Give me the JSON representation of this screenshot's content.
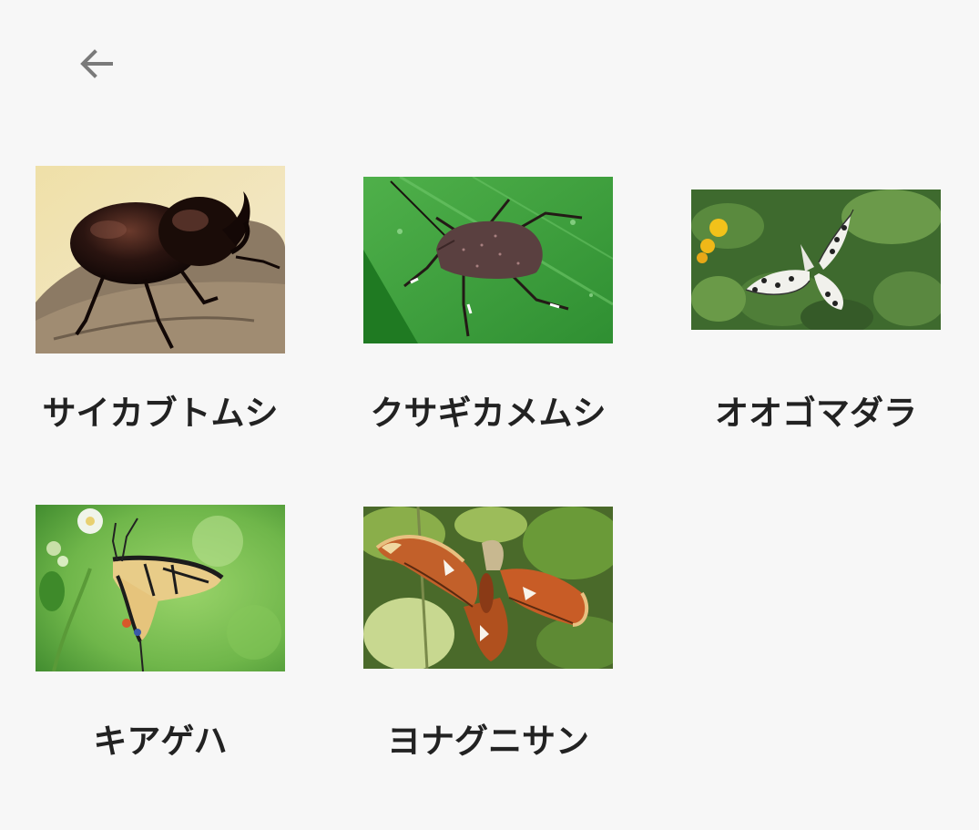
{
  "header": {
    "back_icon": "arrow-left-icon"
  },
  "insects": [
    {
      "name": "サイカブトムシ",
      "image": "rhinoceros-beetle-photo"
    },
    {
      "name": "クサギカメムシ",
      "image": "stink-bug-photo"
    },
    {
      "name": "オオゴマダラ",
      "image": "paper-kite-butterfly-photo"
    },
    {
      "name": "キアゲハ",
      "image": "swallowtail-butterfly-photo"
    },
    {
      "name": "ヨナグニサン",
      "image": "atlas-moth-photo"
    }
  ],
  "colors": {
    "background": "#f7f7f7",
    "label_text": "#222222",
    "icon": "#7a7a7a"
  }
}
